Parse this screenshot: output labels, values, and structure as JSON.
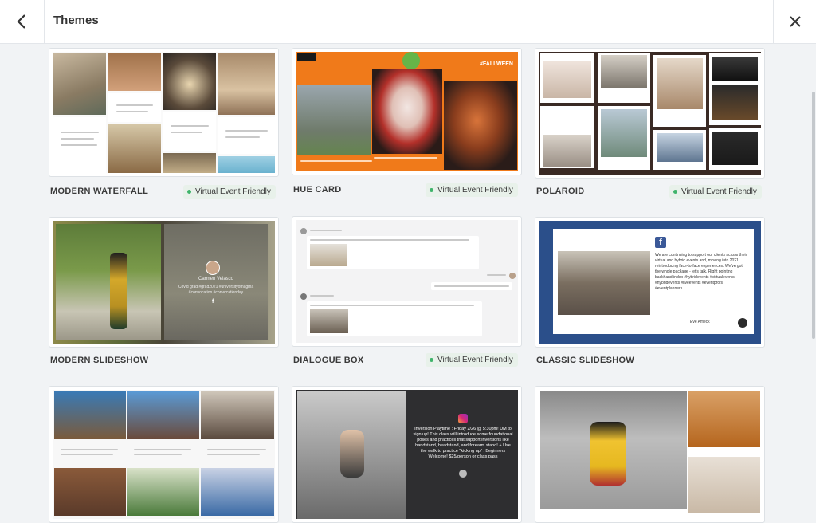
{
  "header": {
    "title": "Themes"
  },
  "badge_text": "Virtual Event Friendly",
  "themes": [
    {
      "name": "MODERN WATERFALL",
      "virtual": true
    },
    {
      "name": "HUE CARD",
      "virtual": true
    },
    {
      "name": "POLAROID",
      "virtual": true
    },
    {
      "name": "MODERN SLIDESHOW",
      "virtual": false
    },
    {
      "name": "DIALOGUE BOX",
      "virtual": true
    },
    {
      "name": "CLASSIC SLIDESHOW",
      "virtual": false
    },
    {
      "name": "",
      "virtual": false
    },
    {
      "name": "",
      "virtual": false
    },
    {
      "name": "",
      "virtual": false
    }
  ],
  "previews": {
    "modern_slideshow_name": "Carmen Velasco",
    "modern_slideshow_text": "Covid grad #grad2021 #universityofnagma #convocation #convocationday",
    "classic_slideshow_text": "We are continuing to support our clients across their virtual and hybrid events and, moving into 2021, reintroducing face-to-face experiences. We've got the whole package - let's talk. Right pointing backhand index #hybridevents #virtualevents #hybridevents #liveevents #eventprofs #eventplanners",
    "classic_slideshow_author": "Eve Affleck",
    "instagram_text": "Inversion Playtime : Friday 2/26 @ 5:30pm! DM to sign up! This class will introduce some foundational poses and practices that support inversions like handstand, headstand, and forearm stand! + Use the walk to practice \"kicking up\" : Beginners Welcome! $25/person or class pass",
    "hue_card_tag": "#FALLWEEN"
  },
  "colors": {
    "hue_orange": "#f07a1a",
    "classic_blue": "#2b4f8a",
    "badge_green": "#3fb46b",
    "badge_bg": "#e8f1ea",
    "facebook_blue": "#3b5998"
  }
}
